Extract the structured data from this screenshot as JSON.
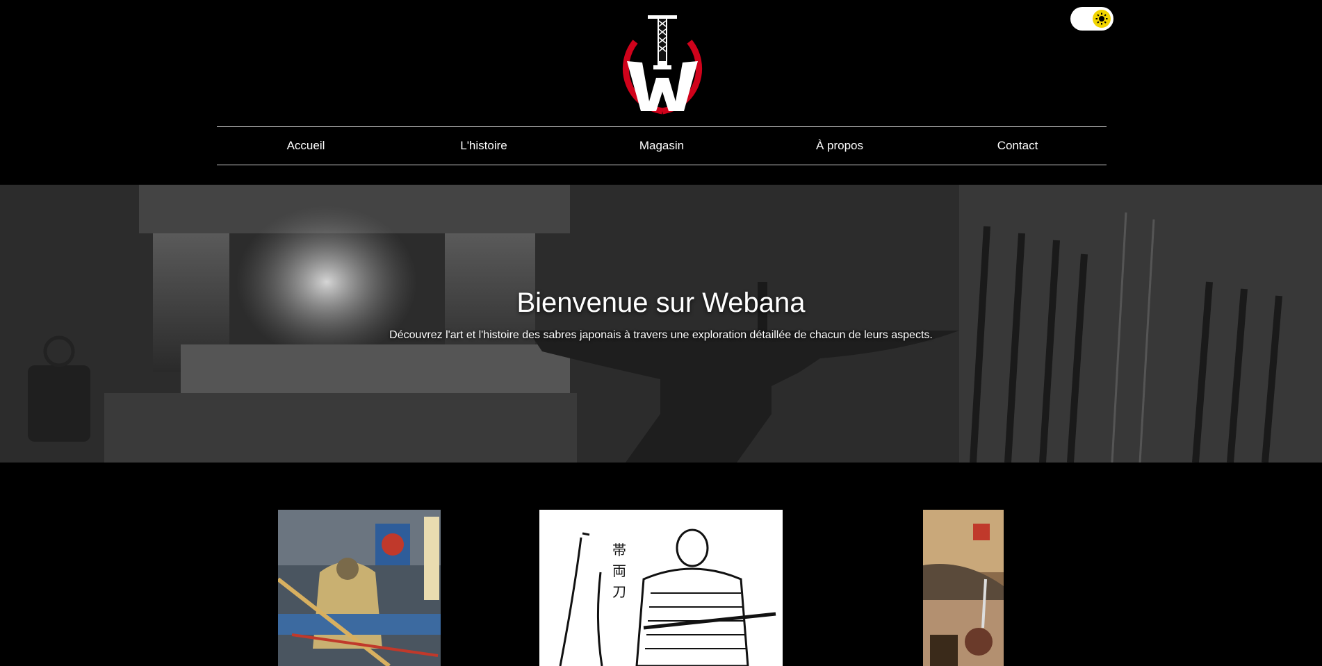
{
  "brand": {
    "logo_icon": "katana-w-logo-icon",
    "accent_color": "#d0021b"
  },
  "theme_toggle": {
    "icon": "sun-icon",
    "color": "#f2d500"
  },
  "nav": {
    "items": [
      {
        "label": "Accueil"
      },
      {
        "label": "L'histoire"
      },
      {
        "label": "Magasin"
      },
      {
        "label": "À propos"
      },
      {
        "label": "Contact"
      }
    ]
  },
  "hero": {
    "title": "Bienvenue sur Webana",
    "subtitle": "Découvrez l'art et l'histoire des sabres japonais à travers une exploration détaillée de chacun de leurs aspects."
  },
  "cards": [
    {
      "image": "samurai-ukiyo-e-image"
    },
    {
      "image": "samurai-armor-swords-illustration-image"
    },
    {
      "image": "samurai-warrior-print-image"
    }
  ]
}
